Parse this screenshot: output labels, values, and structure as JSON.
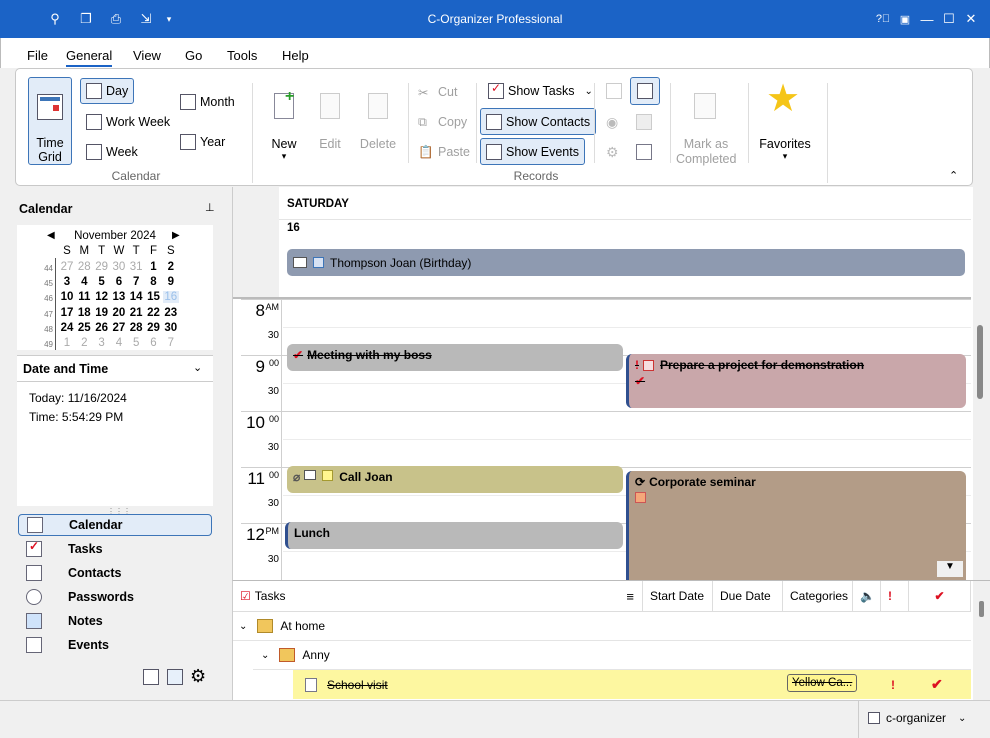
{
  "app": {
    "title": "C-Organizer Professional"
  },
  "menu": {
    "items": [
      "File",
      "General",
      "View",
      "Go",
      "Tools",
      "Help"
    ]
  },
  "ribbon": {
    "calendar_group": {
      "label": "Calendar",
      "time_grid": "Time Grid",
      "day": "Day",
      "work_week": "Work Week",
      "week": "Week",
      "month": "Month",
      "year": "Year"
    },
    "records_group": {
      "label": "Records",
      "new": "New",
      "edit": "Edit",
      "delete": "Delete",
      "cut": "Cut",
      "copy": "Copy",
      "paste": "Paste",
      "show_tasks": "Show Tasks",
      "show_contacts": "Show Contacts",
      "show_events": "Show Events"
    },
    "mark_completed": "Mark as Completed",
    "favorites": "Favorites"
  },
  "left": {
    "calendar_title": "Calendar",
    "month_label": "November 2024",
    "weekdays": [
      "S",
      "M",
      "T",
      "W",
      "T",
      "F",
      "S"
    ],
    "weeks": [
      {
        "num": "44",
        "days": [
          "27",
          "28",
          "29",
          "30",
          "31",
          "1",
          "2"
        ]
      },
      {
        "num": "45",
        "days": [
          "3",
          "4",
          "5",
          "6",
          "7",
          "8",
          "9"
        ]
      },
      {
        "num": "46",
        "days": [
          "10",
          "11",
          "12",
          "13",
          "14",
          "15",
          "16"
        ]
      },
      {
        "num": "47",
        "days": [
          "17",
          "18",
          "19",
          "20",
          "21",
          "22",
          "23"
        ]
      },
      {
        "num": "48",
        "days": [
          "24",
          "25",
          "26",
          "27",
          "28",
          "29",
          "30"
        ]
      },
      {
        "num": "49",
        "days": [
          "1",
          "2",
          "3",
          "4",
          "5",
          "6",
          "7"
        ]
      }
    ],
    "date_time_title": "Date and Time",
    "today": "Today: 11/16/2024",
    "time": "Time: 5:54:29 PM",
    "nav": [
      "Calendar",
      "Tasks",
      "Contacts",
      "Passwords",
      "Notes",
      "Events"
    ]
  },
  "schedule": {
    "day_name": "SATURDAY",
    "day_num": "16",
    "allday_event": "Thompson Joan (Birthday)",
    "hours": [
      {
        "h": "8",
        "m": "AM"
      },
      {
        "h": "9",
        "m": "00"
      },
      {
        "h": "10",
        "m": "00"
      },
      {
        "h": "11",
        "m": "00"
      },
      {
        "h": "12",
        "m": "PM"
      }
    ],
    "half": "30",
    "events": {
      "meeting": "Meeting with my boss",
      "prepare": "Prepare a project for demonstration",
      "call": "Call Joan",
      "seminar": "Corporate seminar",
      "lunch": "Lunch"
    }
  },
  "tasks": {
    "title": "Tasks",
    "columns": {
      "start": "Start Date",
      "due": "Due Date",
      "categories": "Categories"
    },
    "group1": "At home",
    "group2": "Anny",
    "task1": "School visit",
    "task1_category": "Yellow Ca..."
  },
  "status": {
    "account": "c-organizer"
  },
  "colors": {
    "titlebar": "#1b63c6",
    "accent": "#3d75b8",
    "gray_event": "#b9b9b9",
    "pink_event": "#c9a7aa",
    "olive_event": "#c8c28a",
    "brown_event": "#b39c87",
    "allday": "#8e9ab0",
    "task_highlight": "#fdf7a0"
  }
}
